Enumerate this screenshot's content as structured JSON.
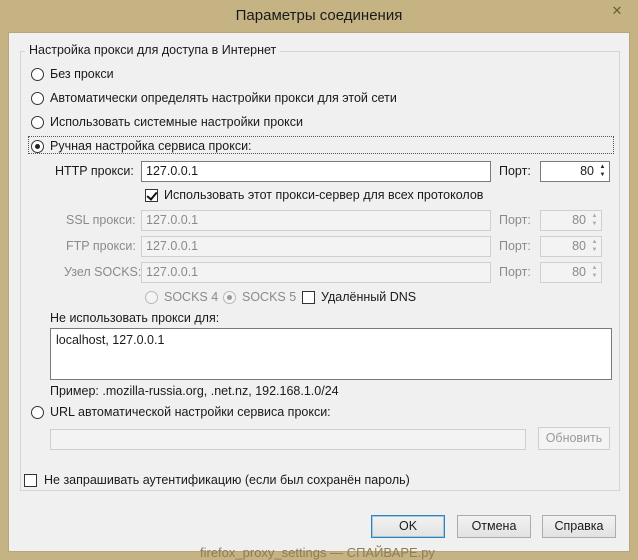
{
  "window": {
    "title": "Параметры соединения",
    "close_symbol": "✕"
  },
  "group": {
    "legend": "Настройка прокси для доступа в Интернет"
  },
  "options": {
    "no_proxy": "Без прокси",
    "auto_detect": "Автоматически определять настройки прокси для этой сети",
    "system": "Использовать системные настройки прокси",
    "manual": "Ручная настройка сервиса прокси:",
    "pac_url": "URL автоматической настройки сервиса прокси:",
    "selected": "manual"
  },
  "manual": {
    "http_label": "HTTP прокси:",
    "http_value": "127.0.0.1",
    "http_port_label": "Порт:",
    "http_port": "80",
    "share_label": "Использовать этот прокси-сервер для всех протоколов",
    "share_checked": true,
    "ssl_label": "SSL прокси:",
    "ssl_value": "127.0.0.1",
    "ssl_port_label": "Порт:",
    "ssl_port": "80",
    "ftp_label": "FTP прокси:",
    "ftp_value": "127.0.0.1",
    "ftp_port_label": "Порт:",
    "ftp_port": "80",
    "socks_label": "Узел SOCKS:",
    "socks_value": "127.0.0.1",
    "socks_port_label": "Порт:",
    "socks_port": "80",
    "socks4_label": "SOCKS 4",
    "socks5_label": "SOCKS 5",
    "socks_version": "SOCKS 5",
    "remote_dns_label": "Удалённый DNS",
    "remote_dns_checked": false
  },
  "no_proxy": {
    "label": "Не использовать прокси для:",
    "value": "localhost, 127.0.0.1",
    "example": "Пример: .mozilla-russia.org, .net.nz, 192.168.1.0/24"
  },
  "pac": {
    "url_value": "",
    "reload_label": "Обновить"
  },
  "auth": {
    "label": "Не запрашивать аутентификацию (если был сохранён пароль)",
    "checked": false
  },
  "buttons": {
    "ok": "OK",
    "cancel": "Отмена",
    "help": "Справка"
  },
  "spin_up": "▲",
  "spin_down": "▼",
  "watermark": "firefox_proxy_settings — СПАЙВАРЕ.ру"
}
